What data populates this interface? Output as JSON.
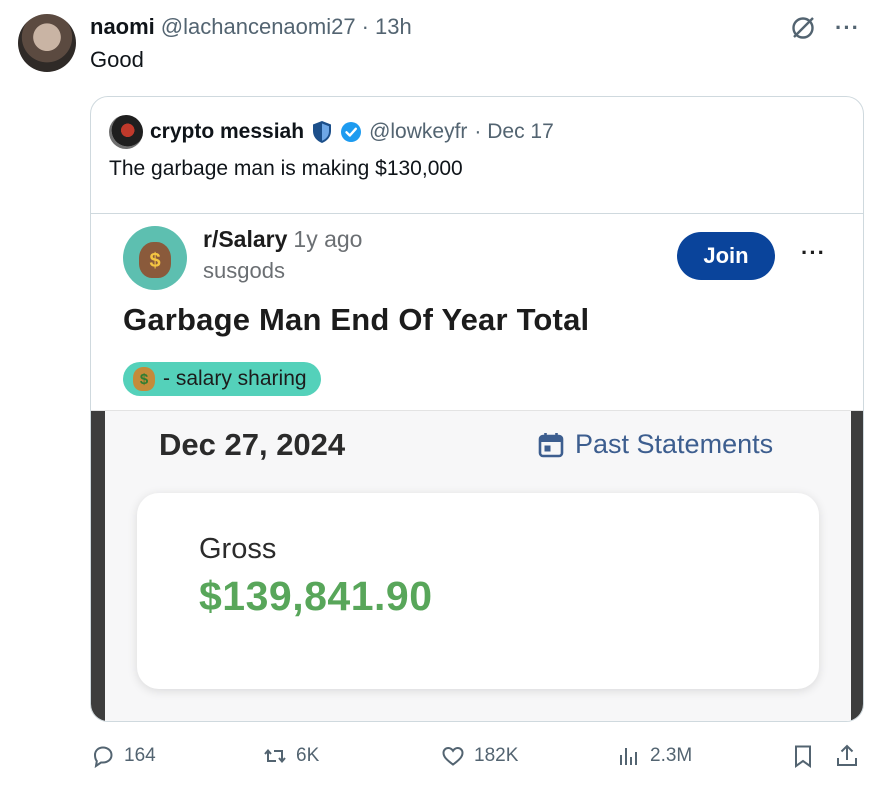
{
  "post": {
    "display_name": "naomi",
    "handle": "@lachancenaomi27",
    "time": "· 13h",
    "text": "Good"
  },
  "quote": {
    "display_name": "crypto messiah",
    "handle": "@lowkeyfr",
    "date": "· Dec 17",
    "text": "The garbage man is making $130,000"
  },
  "reddit": {
    "subreddit": "r/Salary",
    "age": "1y ago",
    "username": "susgods",
    "join_label": "Join",
    "more_label": "···",
    "title": "Garbage Man End Of Year Total",
    "flair": "- salary sharing"
  },
  "statement": {
    "date": "Dec 27, 2024",
    "past_label": "Past Statements",
    "gross_label": "Gross",
    "gross_value": "$139,841.90"
  },
  "actions": {
    "replies": "164",
    "reposts": "6K",
    "likes": "182K",
    "views": "2.3M"
  },
  "colors": {
    "join_bg": "#0a449b",
    "flair_bg": "#54d1ba",
    "gross_green": "#58a65a",
    "past_blue": "#3d5e8f",
    "verified_blue": "#1d9bf0"
  }
}
